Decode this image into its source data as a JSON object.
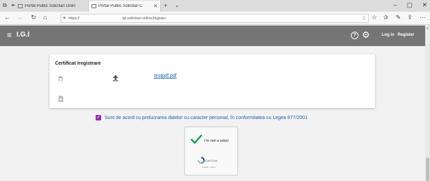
{
  "browser": {
    "tabs": [
      {
        "title": "Portal Public Solicitari Onlin",
        "active": false
      },
      {
        "title": "Portal Public Solicitari C",
        "active": true
      }
    ],
    "url_scheme": "https://",
    "url_path": "igi-solicitari-online/register"
  },
  "app": {
    "brand": "I.G.I",
    "login_label": "Log in",
    "register_label": "Register"
  },
  "certificate": {
    "title": "Certificat Iregistrare",
    "file_name": "testpdf.pdf"
  },
  "consent": {
    "checked": true,
    "text": "Sunt de acord cu prelucrarea datelor cu caracter personal, în conformitatea cu Legea 677/2001"
  },
  "recaptcha": {
    "checked": true,
    "label": "I'm not a robot",
    "brand": "reCAPTCHA",
    "terms": "Privacy - Terms"
  },
  "colors": {
    "navbar": "#757575",
    "link": "#1a5fb4",
    "checkbox": "#9c27b0",
    "check_mark": "#009e55"
  },
  "icons": {
    "delete": "trash-icon",
    "upload": "upload-icon",
    "add_file": "file-add-icon",
    "help": "help-icon",
    "settings": "gear-icon",
    "menu": "hamburger-icon"
  }
}
